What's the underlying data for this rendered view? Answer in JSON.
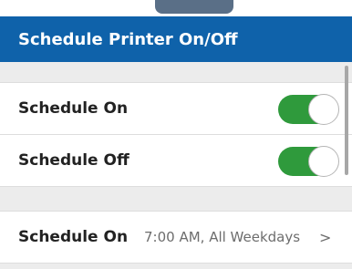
{
  "header": {
    "title": "Schedule Printer On/Off"
  },
  "settings": {
    "schedule_on": {
      "label": "Schedule On",
      "enabled": true
    },
    "schedule_off": {
      "label": "Schedule Off",
      "enabled": true
    }
  },
  "schedule_detail": {
    "label": "Schedule On",
    "value": "7:00 AM,  All Weekdays",
    "chevron": ">"
  },
  "colors": {
    "header_bg": "#0f62aa",
    "toggle_on": "#2f9a3c"
  },
  "icons": {
    "chevron": "chevron-right-icon"
  }
}
